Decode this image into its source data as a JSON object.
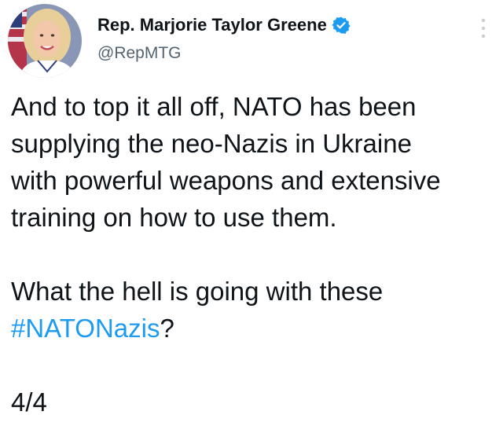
{
  "author": {
    "display_name": "Rep. Marjorie Taylor Greene",
    "handle": "@RepMTG",
    "verified": true,
    "avatar_icon": "profile-photo"
  },
  "tweet": {
    "line1": "And to top it all off, NATO has been",
    "line2": "supplying the neo-Nazis in Ukraine",
    "line3": "with powerful weapons and extensive",
    "line4": "training on how to use them.",
    "line5": "What the hell is going with these",
    "hashtag": "#NATONazis",
    "hashtag_suffix": "?",
    "thread_counter": "4/4"
  },
  "icons": {
    "verified": "verified-badge-icon",
    "more": "more-options-icon"
  },
  "colors": {
    "text": "#0f1419",
    "secondary_text": "#536471",
    "link": "#1d9bf0",
    "verified_badge": "#1d9bf0",
    "background": "#ffffff"
  }
}
